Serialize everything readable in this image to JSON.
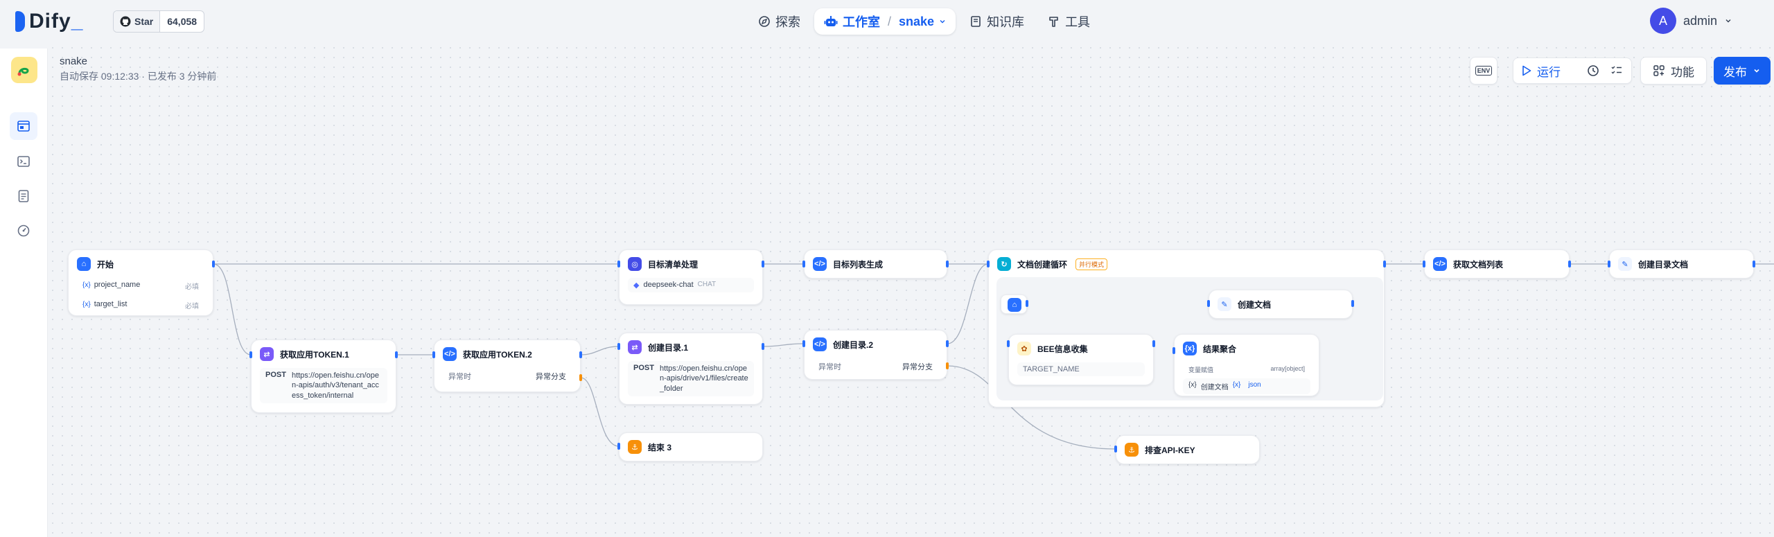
{
  "header": {
    "brand": "Dify",
    "brand_suffix": "_",
    "github_label": "Star",
    "github_stars": "64,058",
    "nav": [
      {
        "label": "探索"
      },
      {
        "label": "工作室",
        "app": "snake"
      },
      {
        "label": "知识库"
      },
      {
        "label": "工具"
      }
    ],
    "user_initial": "A",
    "user_name": "admin"
  },
  "app": {
    "name": "snake",
    "autosave": "自动保存 09:12:33 · 已发布 3 分钟前"
  },
  "toolbar": {
    "env_label": "ENV",
    "run_label": "运行",
    "features_label": "功能",
    "publish_label": "发布"
  },
  "nodes": {
    "start": {
      "title": "开始",
      "vars": [
        {
          "name": "project_name",
          "req": "必填"
        },
        {
          "name": "target_list",
          "req": "必填"
        }
      ]
    },
    "token1": {
      "title": "获取应用TOKEN.1",
      "method": "POST",
      "url": "https://open.feishu.cn/open-apis/auth/v3/tenant_access_token/internal"
    },
    "token2": {
      "title": "获取应用TOKEN.2",
      "left": "异常时",
      "right": "异常分支"
    },
    "target_proc": {
      "title": "目标清单处理",
      "model": "deepseek-chat",
      "mode": "CHAT"
    },
    "target_gen": {
      "title": "目标列表生成"
    },
    "mkdir1": {
      "title": "创建目录.1",
      "method": "POST",
      "url": "https://open.feishu.cn/open-apis/drive/v1/files/create_folder"
    },
    "mkdir2": {
      "title": "创建目录.2",
      "left": "异常时",
      "right": "异常分支"
    },
    "end3": {
      "title": "结束 3"
    },
    "loop": {
      "title": "文档创建循环",
      "badge": "并行模式"
    },
    "create_doc": {
      "title": "创建文档"
    },
    "bee": {
      "title": "BEE信息收集",
      "var": "TARGET_NAME"
    },
    "agg": {
      "title": "结果聚合",
      "col1": "变量赋值",
      "col2": "array[object]",
      "item": "创建文档",
      "item_val": "json"
    },
    "apikey": {
      "title": "排查API-KEY"
    },
    "list_docs": {
      "title": "获取文档列表"
    },
    "mk_index": {
      "title": "创建目录文档"
    }
  }
}
